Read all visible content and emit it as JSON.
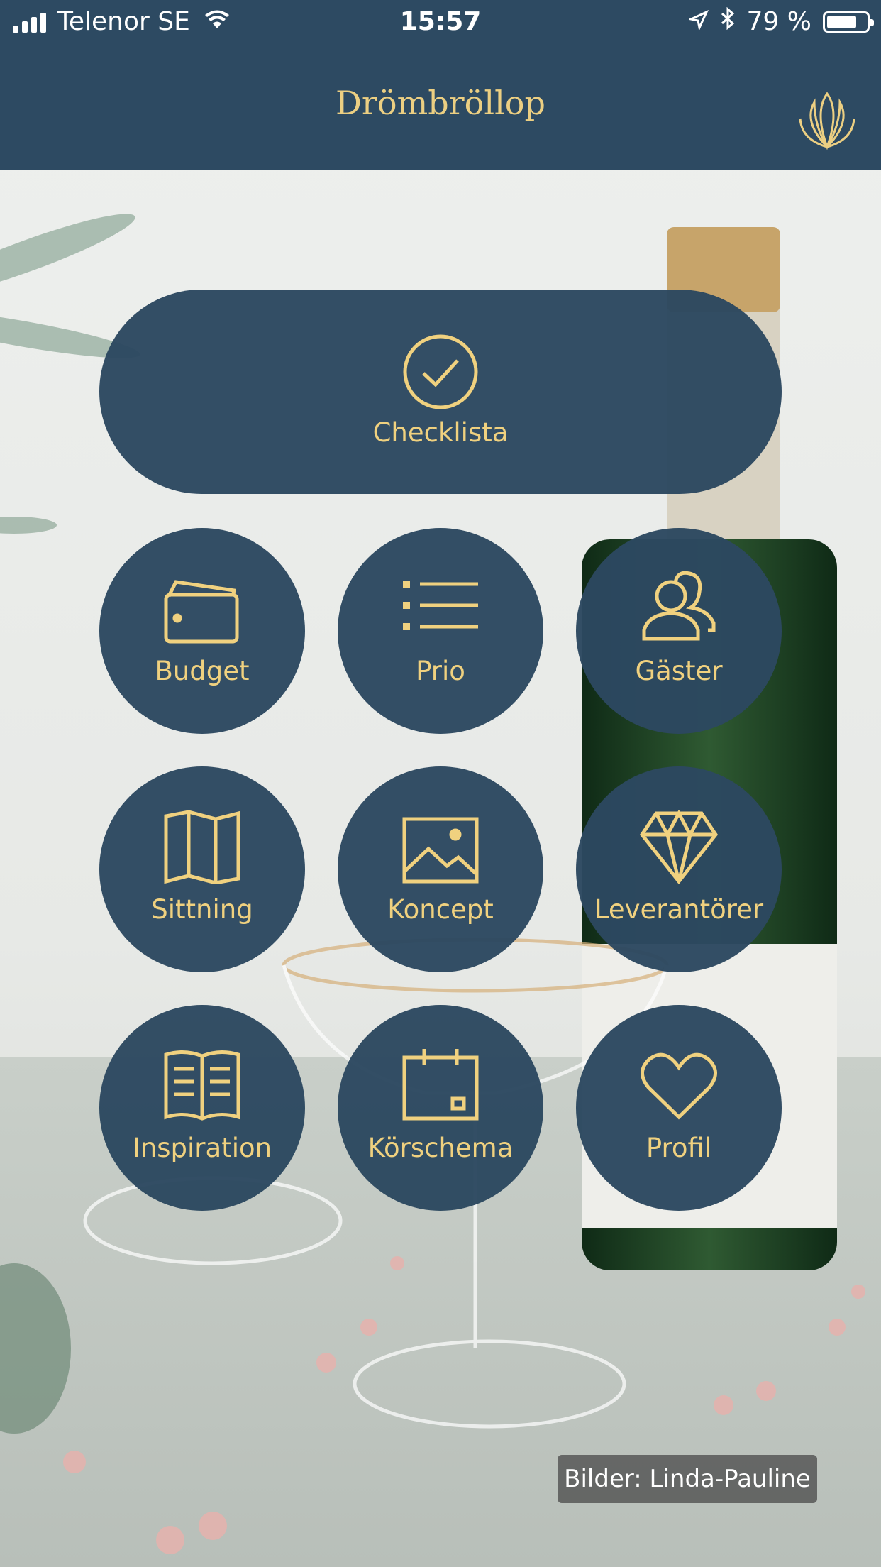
{
  "status_bar": {
    "carrier": "Telenor SE",
    "time": "15:57",
    "battery_percent": "79 %",
    "battery_level": 0.79
  },
  "header": {
    "title": "Drömbröllop",
    "logo_icon": "lotus-icon"
  },
  "menu": {
    "checklist": {
      "label": "Checklista",
      "icon": "check-circle-icon"
    },
    "budget": {
      "label": "Budget",
      "icon": "wallet-icon"
    },
    "prio": {
      "label": "Prio",
      "icon": "list-icon"
    },
    "guests": {
      "label": "Gäster",
      "icon": "users-icon"
    },
    "seating": {
      "label": "Sittning",
      "icon": "map-icon"
    },
    "concept": {
      "label": "Koncept",
      "icon": "image-icon"
    },
    "vendors": {
      "label": "Leverantörer",
      "icon": "diamond-icon"
    },
    "inspiration": {
      "label": "Inspiration",
      "icon": "book-icon"
    },
    "schedule": {
      "label": "Körschema",
      "icon": "calendar-icon"
    },
    "profile": {
      "label": "Profil",
      "icon": "heart-icon"
    }
  },
  "photo_credit": "Bilder: Linda-Pauline",
  "colors": {
    "primary": "#2d4a62",
    "accent_gold": "#f0d17f"
  }
}
